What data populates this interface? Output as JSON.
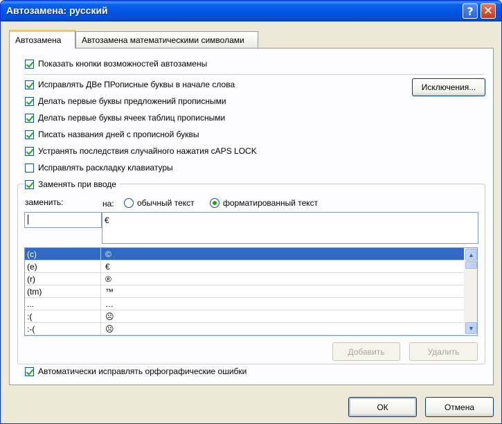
{
  "window": {
    "title": "Автозамена: русский",
    "help_label": "?",
    "close_label": "✕"
  },
  "tabs": [
    {
      "label": "Автозамена"
    },
    {
      "label": "Автозамена математическими символами"
    }
  ],
  "options": {
    "show_buttons": {
      "label": "Показать кнопки возможностей автозамены",
      "checked": true
    },
    "two_caps": {
      "label": "Исправлять ДВе ПРописные буквы в начале слова",
      "checked": true
    },
    "first_letter_sentence": {
      "label": "Делать первые буквы предложений прописными",
      "checked": true
    },
    "first_letter_cells": {
      "label": "Делать первые буквы ячеек таблиц прописными",
      "checked": true
    },
    "day_names": {
      "label": "Писать названия дней с прописной буквы",
      "checked": true
    },
    "caps_lock": {
      "label": "Устранять последствия случайного нажатия cAPS LOCK",
      "checked": true
    },
    "keyboard_layout": {
      "label": "Исправлять раскладку клавиатуры",
      "checked": false
    },
    "replace_as_type": {
      "label": "Заменять при вводе",
      "checked": true
    },
    "auto_spelling": {
      "label": "Автоматически исправлять орфографические ошибки",
      "checked": true
    }
  },
  "buttons": {
    "exceptions": "Исключения...",
    "add": "Добавить",
    "delete": "Удалить",
    "ok": "ОК",
    "cancel": "Отмена"
  },
  "replace": {
    "replace_label": "заменить:",
    "with_label": "на:",
    "plain_text": "обычный текст",
    "formatted_text": "форматированный текст",
    "formatted_selected": true,
    "replace_value": "",
    "with_value": "€"
  },
  "entries": [
    {
      "from": "(c)",
      "to": "©"
    },
    {
      "from": "(e)",
      "to": "€"
    },
    {
      "from": "(r)",
      "to": "®"
    },
    {
      "from": "(tm)",
      "to": "™"
    },
    {
      "from": "...",
      "to": "…"
    },
    {
      "from": ":(",
      "to": "☹"
    },
    {
      "from": ":-(",
      "to": "☹"
    }
  ],
  "colors": {
    "titlebar": "#0054e3",
    "selection": "#316ac5",
    "check": "#21a121",
    "tab_highlight": "#ffc83c"
  }
}
